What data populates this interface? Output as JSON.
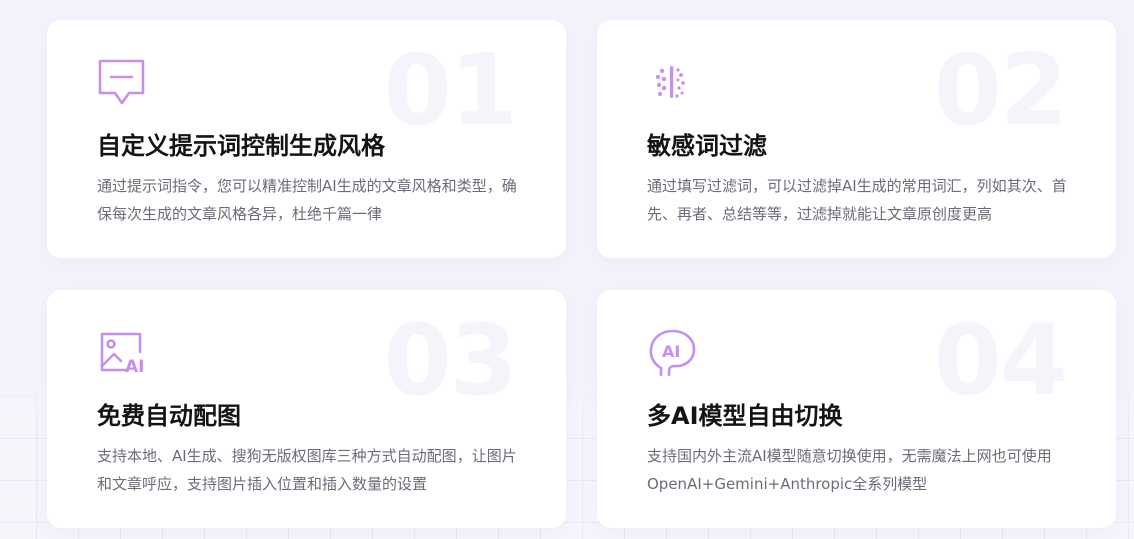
{
  "colors": {
    "accent": "#c48ff0",
    "title": "#141414",
    "description": "#6d6b78",
    "number_watermark": "#f5f4fb",
    "card_background": "#ffffff"
  },
  "features": [
    {
      "number": "01",
      "icon": "chat-bubble-icon",
      "title": "自定义提示词控制生成风格",
      "description": "通过提示词指令，您可以精准控制AI生成的文章风格和类型，确保每次生成的文章风格各异，杜绝千篇一律"
    },
    {
      "number": "02",
      "icon": "filter-dots-icon",
      "title": "敏感词过滤",
      "description": "通过填写过滤词，可以过滤掉AI生成的常用词汇，列如其次、首先、再者、总结等等，过滤掉就能让文章原创度更高"
    },
    {
      "number": "03",
      "icon": "ai-image-icon",
      "title": "免费自动配图",
      "description": "支持本地、AI生成、搜狗无版权图库三种方式自动配图，让图片和文章呼应，支持图片插入位置和插入数量的设置"
    },
    {
      "number": "04",
      "icon": "ai-head-icon",
      "title": "多AI模型自由切换",
      "description": "支持国内外主流AI模型随意切换使用，无需魔法上网也可使用OpenAI+Gemini+Anthropic全系列模型"
    }
  ]
}
